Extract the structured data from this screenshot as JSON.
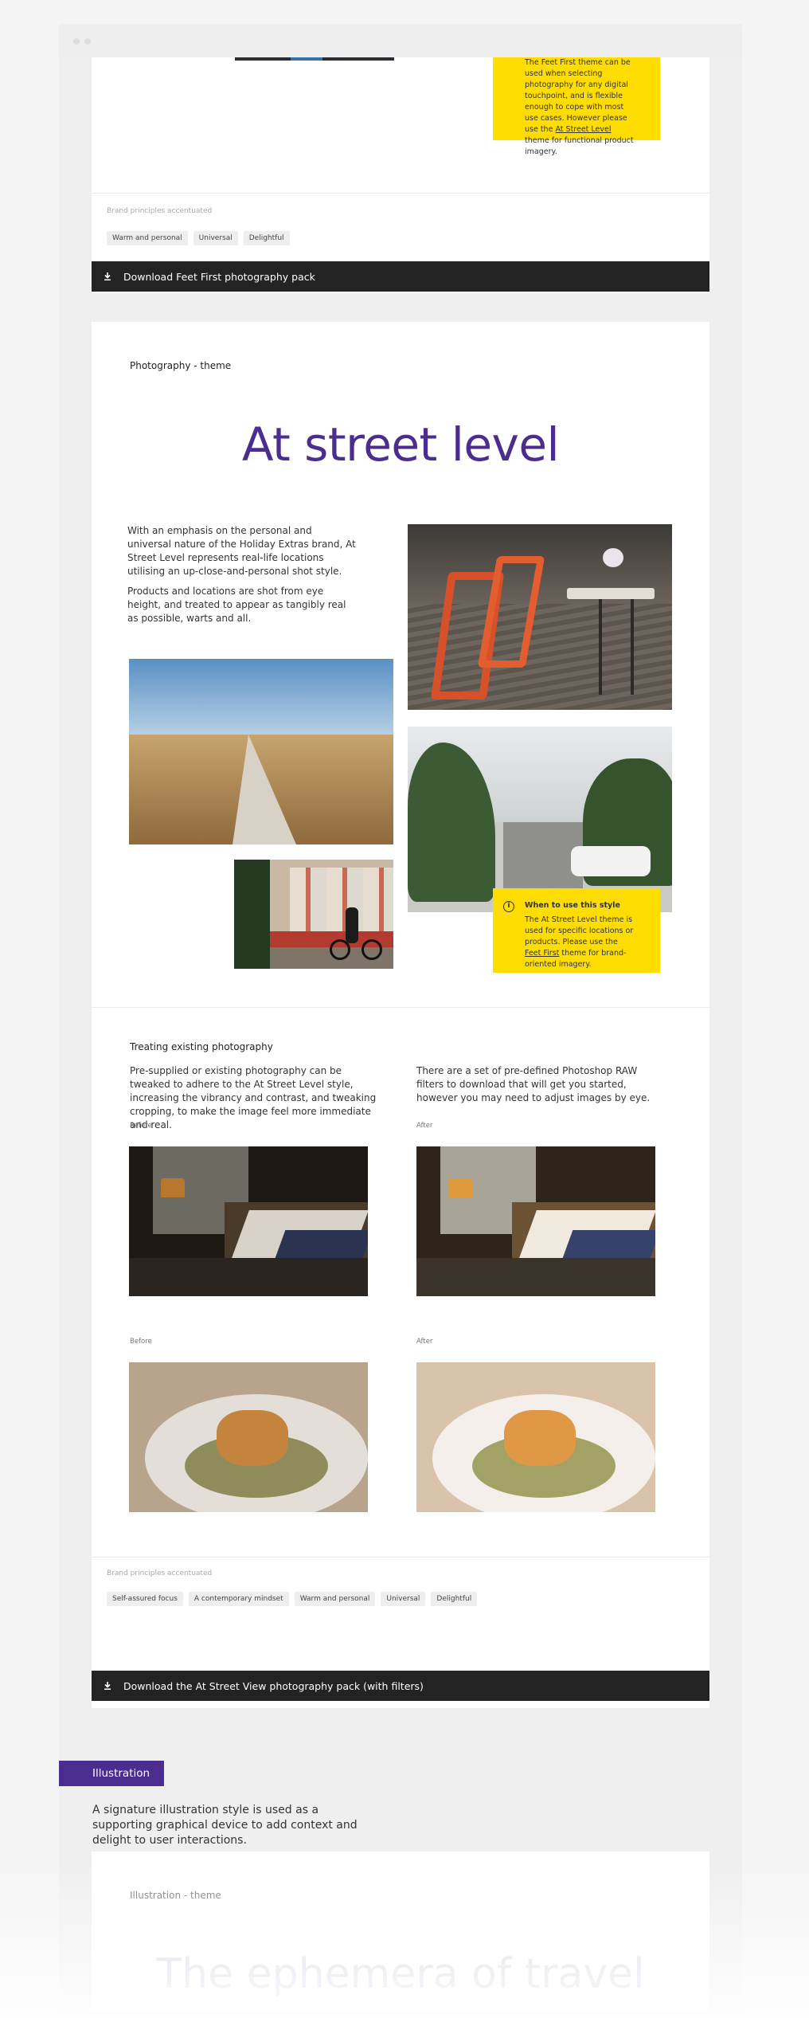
{
  "feet_first_card": {
    "callout_text_before": "The Feet First theme can be used when selecting photography for any digital touchpoint, and is flexible enough to cope with most use cases. However please use the",
    "callout_link": "At Street Level",
    "callout_text_after": "theme for functional product imagery.",
    "principles_label": "Brand principles accentuated",
    "tags": [
      "Warm and personal",
      "Universal",
      "Delightful"
    ],
    "download_label": "Download Feet First photography pack"
  },
  "street_card": {
    "section_label": "Photography - theme",
    "title": "At street level",
    "paragraph_1": "With an emphasis on the personal and universal nature of the Holiday Extras brand, At Street Level represents real-life locations utilising an up-close-and-personal shot style.",
    "paragraph_2": "Products and locations are shot from eye height, and treated to appear as tangibly real as possible, warts and all.",
    "callout": {
      "title": "When to use this style",
      "text_before": "The At Street Level theme is used for specific locations or products. Please use the",
      "link": "Feet First",
      "text_after": "theme for brand-oriented imagery."
    },
    "treating": {
      "title": "Treating existing photography",
      "paragraph_left": "Pre-supplied or existing photography can be tweaked to adhere to the At Street Level style, increasing the vibrancy and contrast, and tweaking cropping, to make the image feel more immediate and real.",
      "paragraph_right": "There are a set of pre-defined Photoshop RAW filters to download that will get you started, however you may need to adjust images by eye.",
      "before_label": "Before",
      "after_label": "After"
    },
    "principles_label": "Brand principles accentuated",
    "tags": [
      "Self-assured focus",
      "A contemporary mindset",
      "Warm and personal",
      "Universal",
      "Delightful"
    ],
    "download_label": "Download the At Street View photography pack (with filters)"
  },
  "illustration": {
    "badge": "Illustration",
    "paragraph": "A signature illustration style is used as a supporting graphical device to add context and delight to user interactions.",
    "section_label": "Illustration - theme",
    "title": "The ephemera of travel"
  },
  "colors": {
    "brand_purple": "#4b2c8f",
    "callout_yellow": "#ffdd00",
    "download_bar": "#232323"
  }
}
